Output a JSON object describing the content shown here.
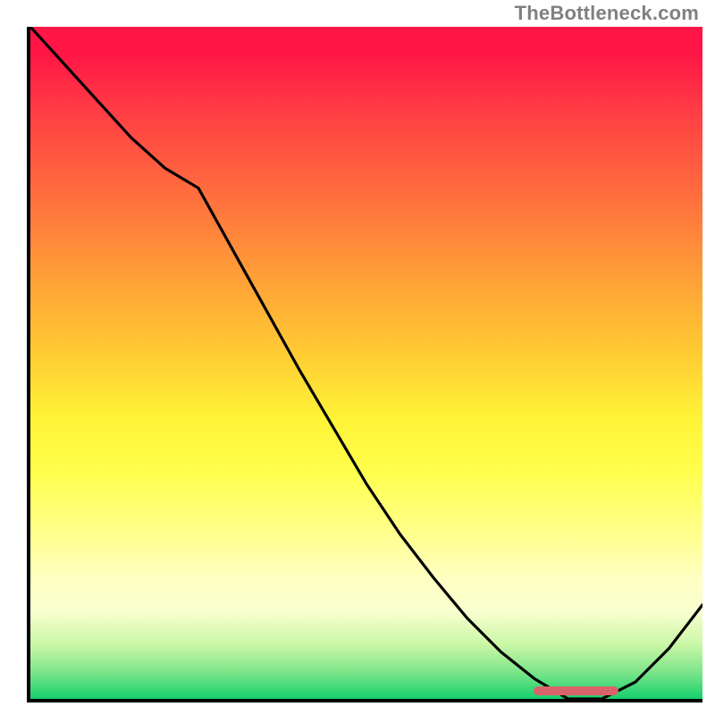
{
  "attribution": "TheBottleneck.com",
  "chart_data": {
    "type": "line",
    "x": [
      0.0,
      0.05,
      0.1,
      0.15,
      0.2,
      0.25,
      0.3,
      0.35,
      0.4,
      0.45,
      0.5,
      0.55,
      0.6,
      0.65,
      0.7,
      0.75,
      0.8,
      0.85,
      0.9,
      0.95,
      1.0
    ],
    "values": [
      1.0,
      0.945,
      0.89,
      0.835,
      0.79,
      0.76,
      0.67,
      0.58,
      0.49,
      0.405,
      0.32,
      0.245,
      0.18,
      0.12,
      0.07,
      0.03,
      0.0,
      0.0,
      0.025,
      0.075,
      0.14
    ],
    "title": "",
    "xlabel": "",
    "ylabel": "",
    "xlim": [
      0,
      1
    ],
    "ylim": [
      0,
      1
    ],
    "grid": false,
    "annotations": [
      {
        "type": "bar",
        "x_start": 0.745,
        "x_end": 0.87,
        "y": 0.003,
        "color": "#d9636a"
      }
    ]
  }
}
